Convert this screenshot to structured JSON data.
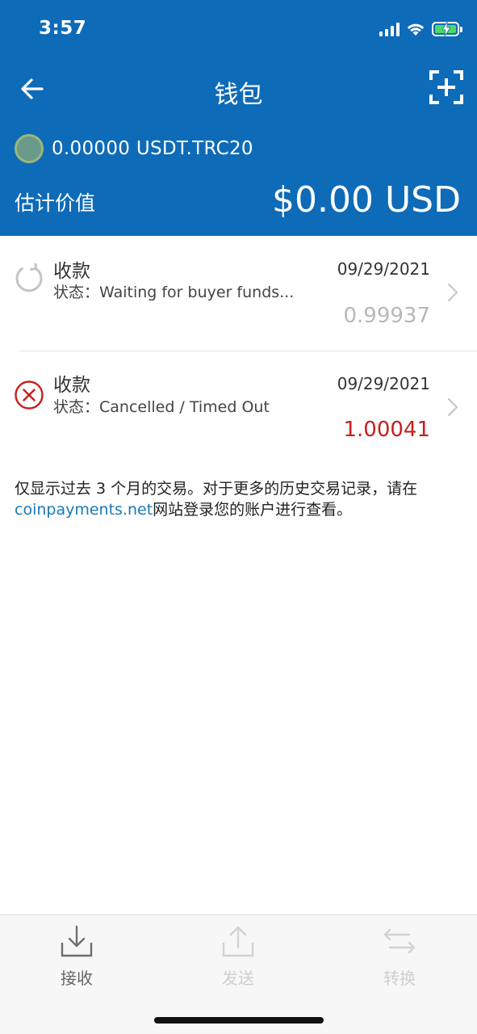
{
  "status_bar": {
    "time": "3:57",
    "icons": [
      "cellular-signal-icon",
      "wifi-icon",
      "battery-charging-icon"
    ]
  },
  "nav": {
    "title": "钱包",
    "back_icon": "arrow-left-icon",
    "scan_icon": "scan-add-icon"
  },
  "wallet": {
    "coin_icon": "coin-icon",
    "balance": "0.00000 USDT.TRC20",
    "estimated_label": "估计价值",
    "estimated_value": "$0.00 USD"
  },
  "transactions": [
    {
      "icon": "pending-refresh-icon",
      "type": "收款",
      "status": "状态：Waiting for buyer funds...",
      "date": "09/29/2021",
      "amount": "0.99937",
      "amount_color": "#b8b8b8"
    },
    {
      "icon": "cancelled-x-icon",
      "type": "收款",
      "status": "状态：Cancelled / Timed Out",
      "date": "09/29/2021",
      "amount": "1.00041",
      "amount_color": "#c81e1e"
    }
  ],
  "note": {
    "line1": "仅显示过去 3 个月的交易。对于更多的历史交易记录，请在",
    "link": "coinpayments.net",
    "line2_suffix": "网站登录您的账户进行查看。"
  },
  "tabbar": {
    "tabs": [
      {
        "label": "接收",
        "icon": "download-tray-icon",
        "enabled": true
      },
      {
        "label": "发送",
        "icon": "upload-tray-icon",
        "enabled": false
      },
      {
        "label": "转换",
        "icon": "swap-arrows-icon",
        "enabled": false
      }
    ]
  },
  "colors": {
    "header_bg": "#0e6bb8",
    "link": "#1a78b8",
    "cancel": "#c81e1e",
    "pending_amount": "#b8b8b8"
  }
}
